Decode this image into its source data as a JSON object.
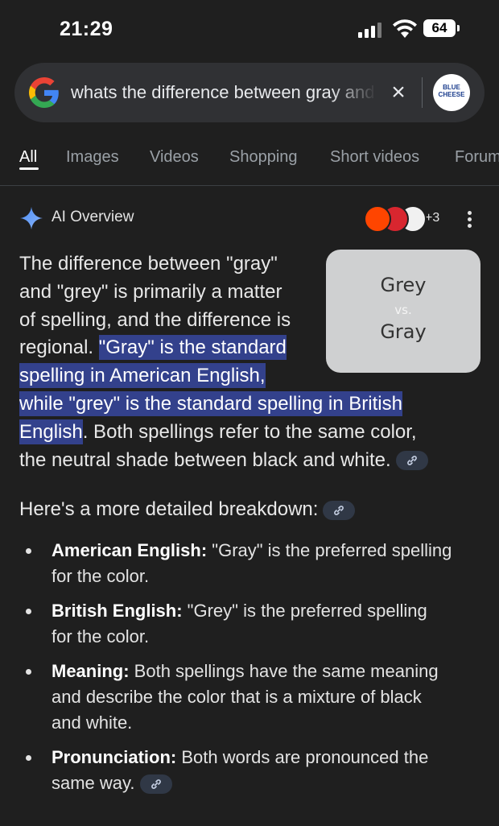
{
  "status_bar": {
    "time": "21:29",
    "battery": "64"
  },
  "search": {
    "query": "whats the difference between gray and grey",
    "avatar_text_line1": "BLUE",
    "avatar_text_line2": "CHEESE"
  },
  "tabs": [
    {
      "label": "All",
      "active": true
    },
    {
      "label": "Images"
    },
    {
      "label": "Videos"
    },
    {
      "label": "Shopping"
    },
    {
      "label": "Short videos"
    },
    {
      "label": "Forums"
    }
  ],
  "ai_overview": {
    "label": "AI Overview",
    "sources_more": "+3",
    "thumbnail": {
      "line1": "Grey",
      "line2": "vs.",
      "line3": "Gray"
    },
    "paragraph_rows": [
      "The difference between \"gray\"",
      "and \"grey\" is primarily a matter",
      "of spelling, and the difference is",
      "regional. ",
      "\"Gray\" is the standard",
      "spelling in American English,",
      "while \"grey\" is the standard spelling in British",
      "English",
      ". Both spellings refer to the same color,",
      "the neutral shade between black and white."
    ],
    "breakdown_title": "Here's a more detailed breakdown:",
    "items": [
      {
        "term": "American English:",
        "text_line1": " \"Gray\" is the preferred spelling",
        "text_line2": "for the color."
      },
      {
        "term": "British English:",
        "text_line1": " \"Grey\" is the preferred spelling",
        "text_line2": "for the color."
      },
      {
        "term": "Meaning:",
        "text_line1": " Both spellings have the same meaning",
        "text_line2": "and describe the color that is a mixture of black",
        "text_line3": "and white."
      },
      {
        "term": "Pronunciation:",
        "text_line1": " Both words are pronounced the",
        "text_line2": "same way."
      }
    ]
  },
  "icons": {
    "search_logo": "google-g-icon",
    "clear": "close-icon",
    "ai": "sparkle-icon",
    "menu": "more-vert-icon",
    "link": "link-icon"
  }
}
